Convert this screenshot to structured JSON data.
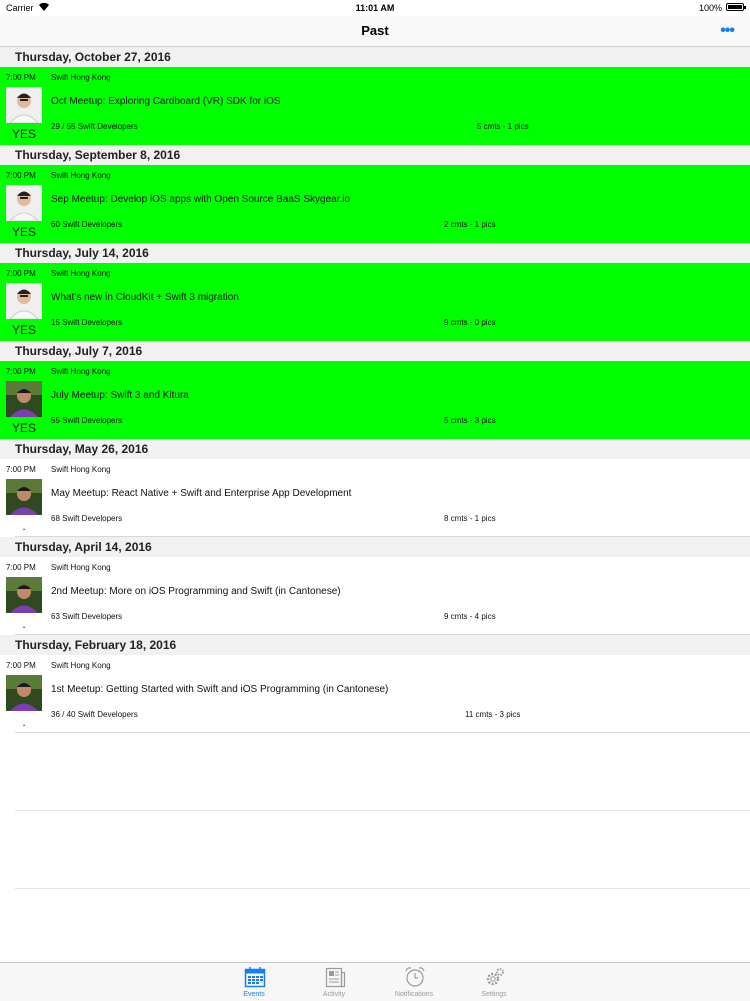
{
  "status_bar": {
    "carrier": "Carrier",
    "time": "11:01 AM",
    "battery": "100%"
  },
  "nav": {
    "title": "Past",
    "more_glyph": "•••"
  },
  "sections": [
    {
      "date": "Thursday, October 27, 2016",
      "event": {
        "time": "7:00 PM",
        "group": "Swift Hong Kong",
        "name": "Oct Meetup: Exploring Cardboard (VR) SDK for iOS",
        "members": "29 / 55 Swift Developers",
        "stats": "5 cmts - 1 pics",
        "rsvp": "YES",
        "joined": true,
        "avatar": "a"
      }
    },
    {
      "date": "Thursday, September 8, 2016",
      "event": {
        "time": "7:00 PM",
        "group": "Swift Hong Kong",
        "name": "Sep Meetup: Develop iOS apps with Open Source BaaS Skygear.io",
        "members": "60 Swift Developers",
        "stats": "2 cmts - 1 pics",
        "rsvp": "YES",
        "joined": true,
        "avatar": "a"
      }
    },
    {
      "date": "Thursday, July 14, 2016",
      "event": {
        "time": "7:00 PM",
        "group": "Swift Hong Kong",
        "name": "What's new in CloudKit + Swift 3 migration",
        "members": "15 Swift Developers",
        "stats": "9 cmts - 0 pics",
        "rsvp": "YES",
        "joined": true,
        "avatar": "a"
      }
    },
    {
      "date": "Thursday, July 7, 2016",
      "event": {
        "time": "7:00 PM",
        "group": "Swift Hong Kong",
        "name": "July Meetup: Swift 3 and Kitura",
        "members": "55 Swift Developers",
        "stats": "5 cmts - 3 pics",
        "rsvp": "YES",
        "joined": true,
        "avatar": "b"
      }
    },
    {
      "date": "Thursday, May 26, 2016",
      "event": {
        "time": "7:00 PM",
        "group": "Swift Hong Kong",
        "name": "May Meetup: React Native + Swift and Enterprise App Development",
        "members": "68 Swift Developers",
        "stats": "8 cmts - 1 pics",
        "rsvp": ".",
        "joined": false,
        "avatar": "b"
      }
    },
    {
      "date": "Thursday, April 14, 2016",
      "event": {
        "time": "7:00 PM",
        "group": "Swift Hong Kong",
        "name": "2nd Meetup: More on iOS Programming and Swift (in Cantonese)",
        "members": "63 Swift Developers",
        "stats": "9 cmts - 4 pics",
        "rsvp": ".",
        "joined": false,
        "avatar": "b"
      }
    },
    {
      "date": "Thursday, February 18, 2016",
      "event": {
        "time": "7:00 PM",
        "group": "Swift Hong Kong",
        "name": "1st Meetup: Getting Started with Swift and iOS Programming (in Cantonese)",
        "members": "36 / 40 Swift Developers",
        "stats": "11 cmts - 3 pics",
        "rsvp": ".",
        "joined": false,
        "avatar": "b"
      }
    }
  ],
  "tabs": [
    {
      "label": "Events",
      "icon": "calendar-icon",
      "active": true
    },
    {
      "label": "Activity",
      "icon": "newspaper-icon",
      "active": false
    },
    {
      "label": "Notifications",
      "icon": "alarm-clock-icon",
      "active": false
    },
    {
      "label": "Settings",
      "icon": "gear-icon",
      "active": false
    }
  ],
  "colors": {
    "joined_row": "#00ff00",
    "accent": "#1a7cf5"
  }
}
